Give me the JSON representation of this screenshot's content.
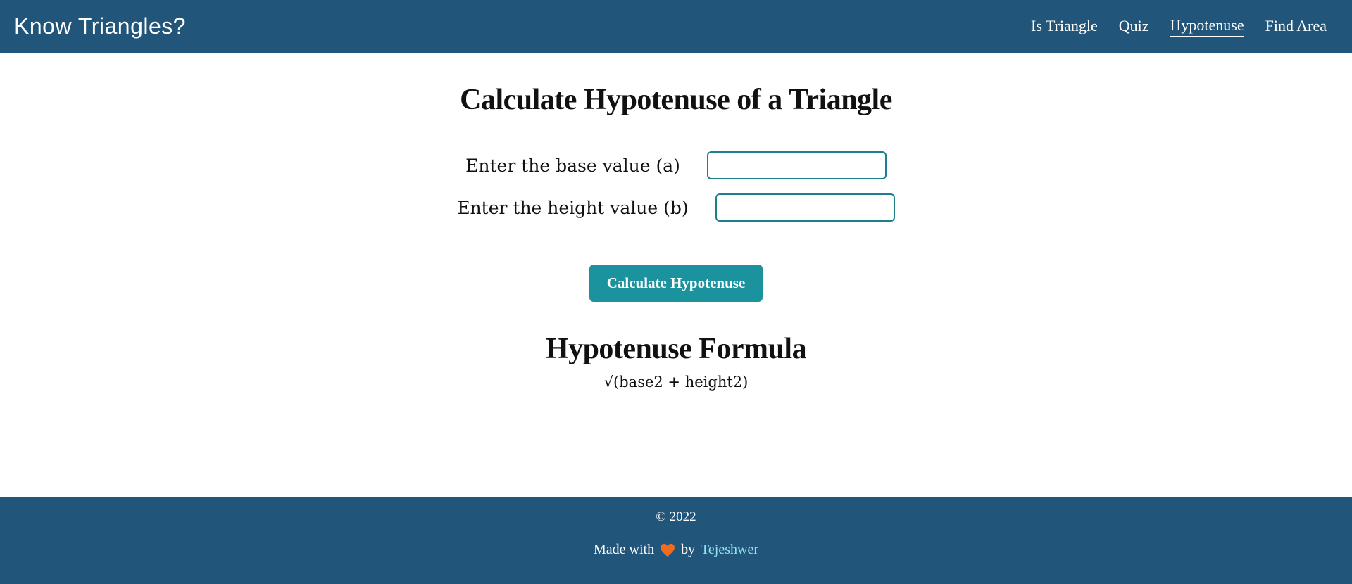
{
  "navbar": {
    "brand": "Know Triangles?",
    "links": [
      {
        "label": "Is Triangle"
      },
      {
        "label": "Quiz"
      },
      {
        "label": "Hypotenuse"
      },
      {
        "label": "Find Area"
      }
    ],
    "active_link": "Hypotenuse"
  },
  "main": {
    "title": "Calculate Hypotenuse of a Triangle",
    "base_label": "Enter the base value (a)",
    "base_value": "",
    "height_label": "Enter the height value (b)",
    "height_value": "",
    "button_label": "Calculate Hypotenuse",
    "formula_title": "Hypotenuse Formula",
    "formula": "√(base2 + height2)"
  },
  "footer": {
    "copyright": "© 2022",
    "made_with": "Made with",
    "by": "by",
    "author": "Tejeshwer",
    "heart_color": "#f26a1b"
  },
  "colors": {
    "header_bg": "#22557a",
    "button_bg": "#1a939f",
    "input_border": "#1e7f8c",
    "author_link": "#8ee6f0"
  }
}
